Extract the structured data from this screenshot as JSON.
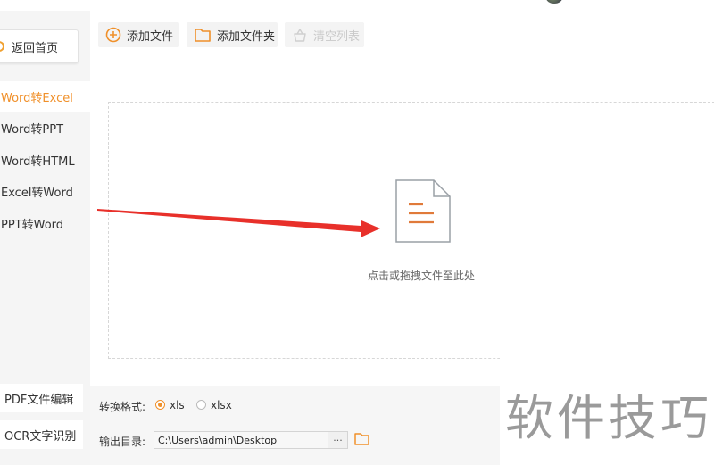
{
  "sidebar": {
    "back_label": "返回首页",
    "items": [
      {
        "label": "Word转Excel",
        "active": true
      },
      {
        "label": "Word转PPT",
        "active": false
      },
      {
        "label": "Word转HTML",
        "active": false
      },
      {
        "label": "Excel转Word",
        "active": false
      },
      {
        "label": "PPT转Word",
        "active": false
      }
    ],
    "tools": [
      "PDF文件编辑",
      "OCR文字识别"
    ]
  },
  "toolbar": {
    "add_file": "添加文件",
    "add_folder": "添加文件夹",
    "clear_list": "清空列表"
  },
  "dropzone": {
    "hint": "点击或拖拽文件至此处"
  },
  "settings": {
    "format_label": "转换格式:",
    "formats": [
      "xls",
      "xlsx"
    ],
    "selected_format": "xls",
    "output_label": "输出目录:",
    "output_path": "C:\\Users\\admin\\Desktop",
    "browse_label": "···"
  },
  "watermark": "软件技巧",
  "colors": {
    "accent": "#f0902a",
    "arrow": "#e8302a",
    "doc_icon": "#e07a3a"
  }
}
